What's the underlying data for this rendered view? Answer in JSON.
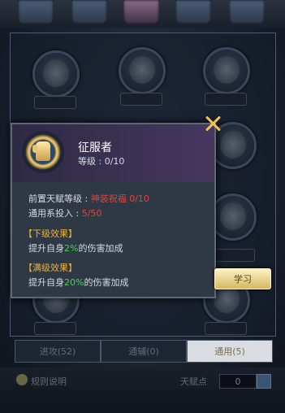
{
  "popup": {
    "title": "征服者",
    "level_label": "等级 : ",
    "level_value": "0/10",
    "prereq_label": "前置天赋等级 : ",
    "prereq_value": "神装祝福 0/10",
    "invest_label": "通用系投入 : ",
    "invest_value": "5/50",
    "next_effect_header": "【下级效果】",
    "next_effect_pre": "提升自身",
    "next_effect_pct": "2%",
    "next_effect_post": "的伤害加成",
    "max_effect_header": "【满级效果】",
    "max_effect_pre": "提升自身",
    "max_effect_pct": "20%",
    "max_effect_post": "的伤害加成",
    "icon": "fist-icon"
  },
  "learn_button": "学习",
  "close_icon": "close-icon",
  "tabs": [
    "进攻(52)",
    "通辅(0)",
    "通用(5)"
  ],
  "bottom": {
    "rules_label": "规则说明",
    "points_label": "天赋点",
    "points_value": "0"
  },
  "colors": {
    "accent_gold": "#f1c35b",
    "red": "#e0443b",
    "green": "#47d45a",
    "header_gold": "#e8b43c"
  }
}
